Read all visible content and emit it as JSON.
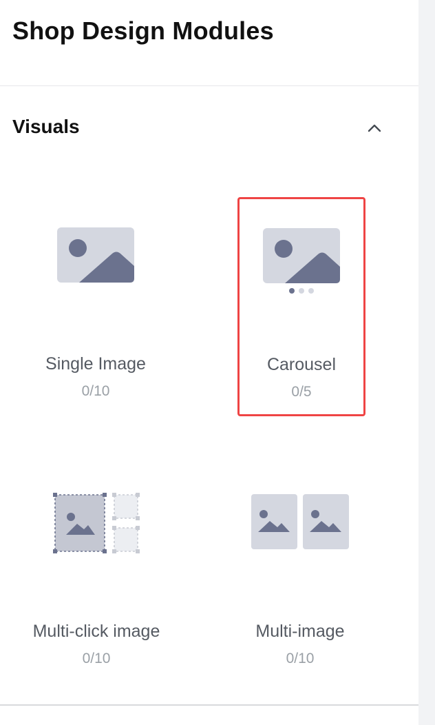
{
  "panel": {
    "title": "Shop Design Modules"
  },
  "sections": [
    {
      "title": "Visuals",
      "collapse_icon": "chevron-up-icon",
      "modules": [
        {
          "label": "Single Image",
          "count": "0/10",
          "icon": "image-icon",
          "selected": false
        },
        {
          "label": "Carousel",
          "count": "0/5",
          "icon": "carousel-icon",
          "selected": true
        },
        {
          "label": "Multi-click image",
          "count": "0/10",
          "icon": "multi-click-image-icon",
          "selected": false
        },
        {
          "label": "Multi-image",
          "count": "0/10",
          "icon": "multi-image-icon",
          "selected": false
        }
      ]
    }
  ],
  "colors": {
    "selected_border": "#ef4444",
    "icon_bg": "#d4d7e0",
    "icon_fg": "#6b728e",
    "label_text": "#555a62",
    "count_text": "#9aa0a6"
  }
}
